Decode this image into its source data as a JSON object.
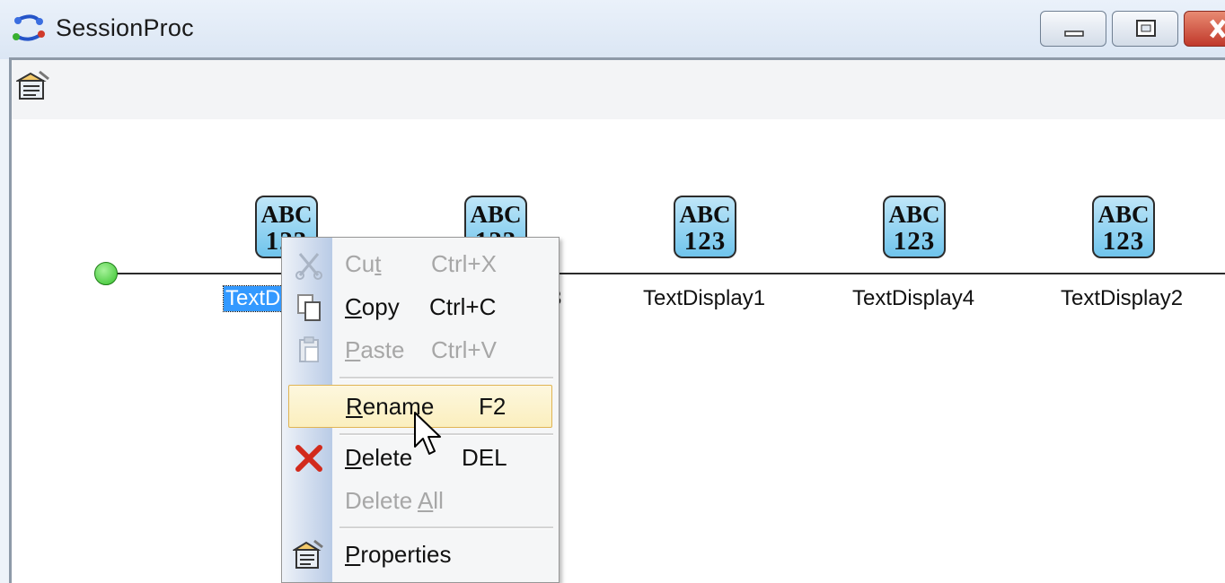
{
  "window": {
    "title": "SessionProc",
    "app_icon": "session-flow-icon",
    "controls": [
      "minimize",
      "maximize",
      "close"
    ]
  },
  "toolbar": {
    "properties_icon": "properties-icon"
  },
  "flow": {
    "start_node": "start-node",
    "nodes": [
      {
        "label": "TextD",
        "icon_line1": "ABC",
        "icon_line2": "123",
        "selected": true
      },
      {
        "label": "3",
        "icon_line1": "ABC",
        "icon_line2": "123",
        "selected": false
      },
      {
        "label": "TextDisplay1",
        "icon_line1": "ABC",
        "icon_line2": "123",
        "selected": false
      },
      {
        "label": "TextDisplay4",
        "icon_line1": "ABC",
        "icon_line2": "123",
        "selected": false
      },
      {
        "label": "TextDisplay2",
        "icon_line1": "ABC",
        "icon_line2": "123",
        "selected": false
      }
    ]
  },
  "context_menu": {
    "items": [
      {
        "id": "cut",
        "label_pre": "Cu",
        "label_u": "t",
        "label_post": "",
        "shortcut": "Ctrl+X",
        "enabled": false,
        "icon": "scissors-icon"
      },
      {
        "id": "copy",
        "label_pre": "",
        "label_u": "C",
        "label_post": "opy",
        "shortcut": "Ctrl+C",
        "enabled": true,
        "icon": "copy-icon"
      },
      {
        "id": "paste",
        "label_pre": "",
        "label_u": "P",
        "label_post": "aste",
        "shortcut": "Ctrl+V",
        "enabled": false,
        "icon": "paste-icon"
      },
      {
        "id": "rename",
        "label_pre": "",
        "label_u": "R",
        "label_post": "ename",
        "shortcut": "F2",
        "enabled": true,
        "highlighted": true
      },
      {
        "id": "delete",
        "label_pre": "",
        "label_u": "D",
        "label_post": "elete",
        "shortcut": "DEL",
        "enabled": true,
        "icon": "delete-x-icon"
      },
      {
        "id": "delete_all",
        "label_pre": "Delete ",
        "label_u": "A",
        "label_post": "ll",
        "shortcut": "",
        "enabled": false
      },
      {
        "id": "properties",
        "label_pre": "",
        "label_u": "P",
        "label_post": "roperties",
        "shortcut": "",
        "enabled": true,
        "icon": "properties-icon"
      }
    ]
  },
  "colors": {
    "selection": "#3399ff",
    "menu_highlight": "#fbefbe",
    "start_node": "#36c22c",
    "node_icon": "#6fc4ec"
  }
}
